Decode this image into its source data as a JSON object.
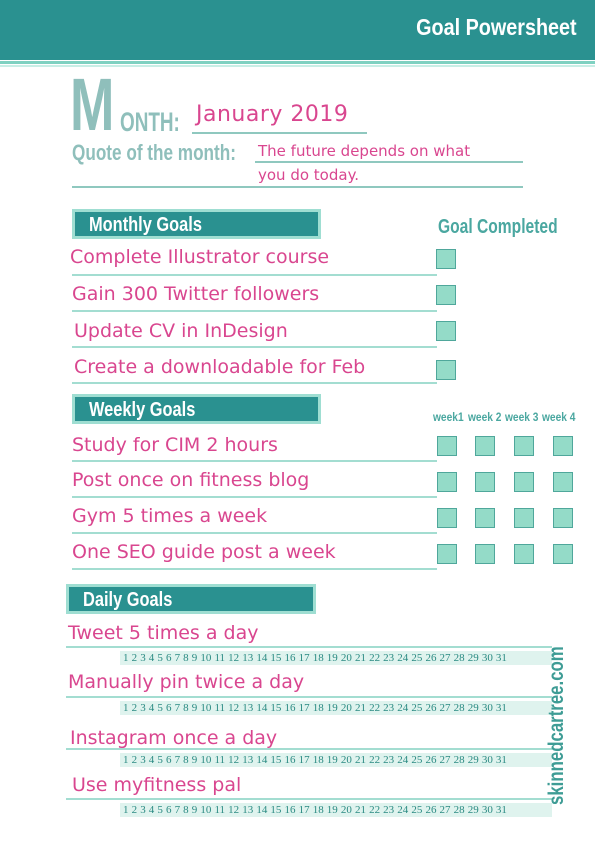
{
  "header": {
    "title": "Goal Powersheet"
  },
  "month": {
    "label_initial": "M",
    "label_rest": "ONTH:",
    "value": "January 2019"
  },
  "quote": {
    "label": "Quote of the month:",
    "line1": "The future depends on what",
    "line2": "you do today."
  },
  "monthly": {
    "title": "Monthly Goals",
    "column_header": "Goal Completed",
    "goals": [
      {
        "text": "Complete Illustrator course",
        "completed": false
      },
      {
        "text": "Gain 300 Twitter followers",
        "completed": false
      },
      {
        "text": "Update CV in InDesign",
        "completed": false
      },
      {
        "text": "Create a downloadable for Feb",
        "completed": false
      }
    ]
  },
  "weekly": {
    "title": "Weekly Goals",
    "week_headers": [
      "week1",
      "week 2",
      "week 3",
      "week 4"
    ],
    "goals": [
      {
        "text": "Study for CIM 2 hours",
        "weeks": [
          false,
          false,
          false,
          false
        ]
      },
      {
        "text": "Post once on fitness blog",
        "weeks": [
          false,
          false,
          false,
          false
        ]
      },
      {
        "text": "Gym 5 times a week",
        "weeks": [
          false,
          false,
          false,
          false
        ]
      },
      {
        "text": "One SEO guide post a week",
        "weeks": [
          false,
          false,
          false,
          false
        ]
      }
    ]
  },
  "daily": {
    "title": "Daily Goals",
    "days": [
      "1",
      "2",
      "3",
      "4",
      "5",
      "6",
      "7",
      "8",
      "9",
      "10",
      "11",
      "12",
      "13",
      "14",
      "15",
      "16",
      "17",
      "18",
      "19",
      "20",
      "21",
      "22",
      "23",
      "24",
      "25",
      "26",
      "27",
      "28",
      "29",
      "30",
      "31"
    ],
    "goals": [
      {
        "text": "Tweet 5 times a day"
      },
      {
        "text": "Manually pin twice a day"
      },
      {
        "text": "Instagram once a day"
      },
      {
        "text": "Use myfitness pal"
      }
    ]
  },
  "watermark": "skinnedcartree.com",
  "colors": {
    "brand_teal": "#2a9190",
    "mint": "#94dbc8",
    "handwriting_pink": "#d9468f",
    "label_grey_teal": "#8fbfbb"
  }
}
